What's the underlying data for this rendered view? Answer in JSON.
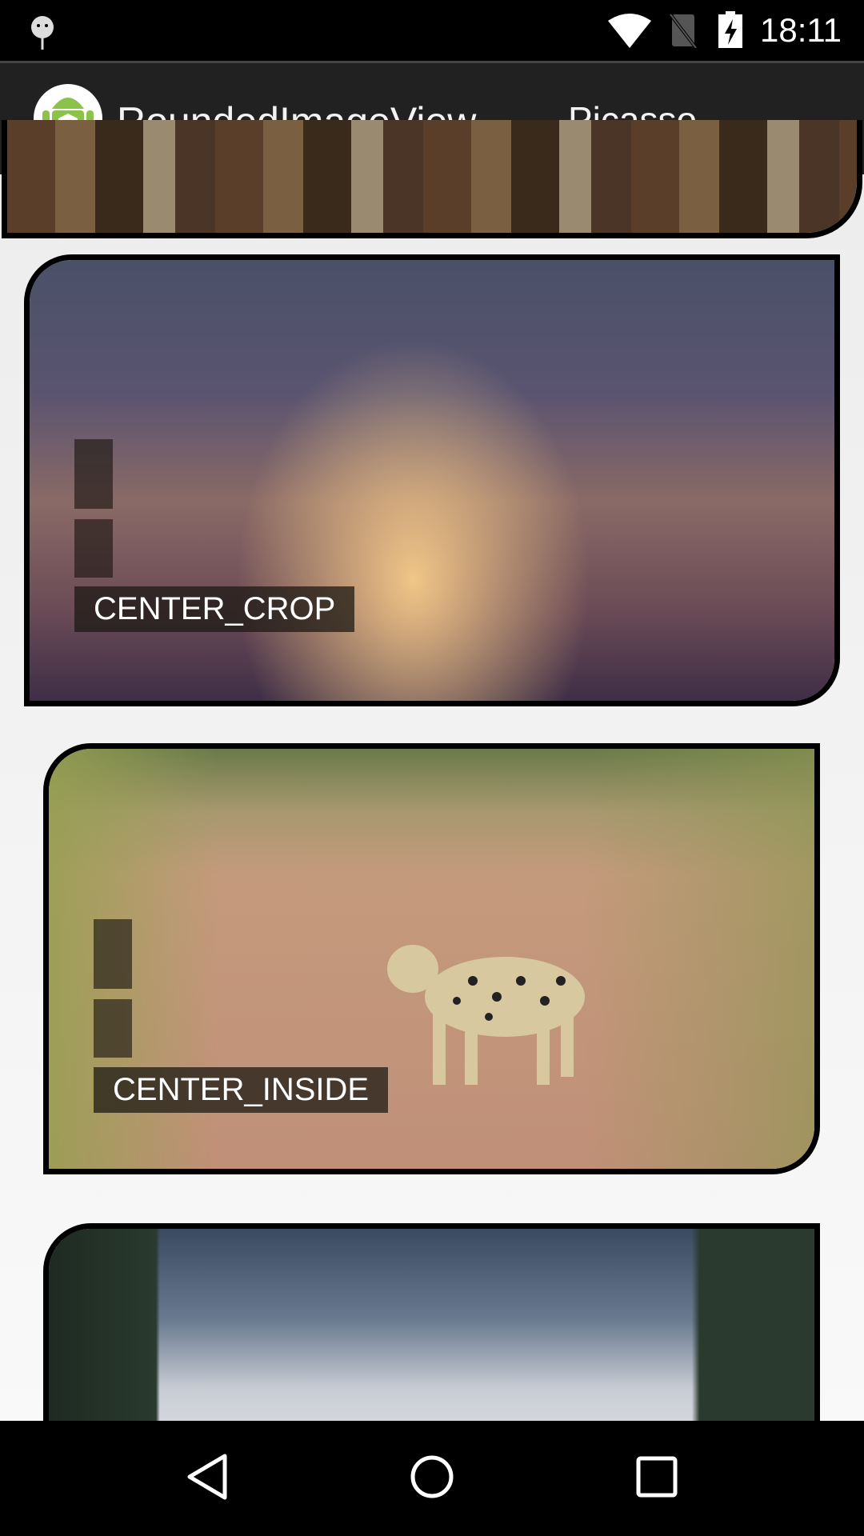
{
  "status_bar": {
    "time": "18:11",
    "icons": [
      "android-debug-icon",
      "wifi-icon",
      "no-sim-icon",
      "battery-charging-icon"
    ]
  },
  "app_bar": {
    "title": "RoundedImageView",
    "spinner_value": "Picasso"
  },
  "cards": [
    {
      "label": ""
    },
    {
      "label": "CENTER_CROP"
    },
    {
      "label": "CENTER_INSIDE"
    },
    {
      "label": ""
    }
  ],
  "nav_bar": {
    "icons": [
      "back-icon",
      "home-icon",
      "recents-icon"
    ]
  }
}
